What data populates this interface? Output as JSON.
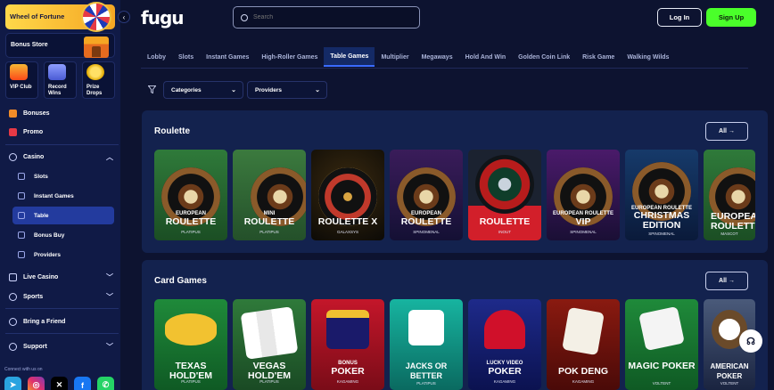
{
  "sidebar": {
    "wheel_label": "Wheel of Fortune",
    "bonus_store_label": "Bonus Store",
    "tiles": [
      {
        "label": "VIP Club",
        "icon": "crown-icon"
      },
      {
        "label": "Record Wins",
        "icon": "trophy-icon"
      },
      {
        "label": "Prize Drops",
        "icon": "coin-icon"
      }
    ],
    "items": {
      "bonuses": "Bonuses",
      "promo": "Promo",
      "casino": "Casino",
      "slots": "Slots",
      "instant_games": "Instant Games",
      "table": "Table",
      "bonus_buy": "Bonus Buy",
      "providers": "Providers",
      "live_casino": "Live Casino",
      "sports": "Sports",
      "bring_friend": "Bring a Friend",
      "support": "Support"
    },
    "connect_label": "Connect with us on",
    "socials": [
      "telegram-icon",
      "instagram-icon",
      "x-icon",
      "facebook-icon",
      "whatsapp-icon"
    ]
  },
  "header": {
    "logo": "fugu",
    "search_placeholder": "Search",
    "login_label": "Log In",
    "signup_label": "Sign Up"
  },
  "tabs": [
    "Lobby",
    "Slots",
    "Instant Games",
    "High-Roller Games",
    "Table Games",
    "Multiplier",
    "Megaways",
    "Hold And Win",
    "Golden Coin Link",
    "Risk Game",
    "Walking Wilds"
  ],
  "active_tab": "Table Games",
  "filters": {
    "categories_label": "Categories",
    "providers_label": "Providers"
  },
  "roulette": {
    "title": "Roulette",
    "all_label": "All",
    "games": [
      {
        "line1": "EUROPEAN",
        "line2": "ROULETTE",
        "provider": "PLATIPUS"
      },
      {
        "line1": "MINI",
        "line2": "ROULETTE",
        "provider": "PLATIPUS"
      },
      {
        "line1": "",
        "line2": "ROULETTE X",
        "provider": "GALAXSYS"
      },
      {
        "line1": "EUROPEAN",
        "line2": "ROULETTE",
        "provider": "SPINOMENAL"
      },
      {
        "line1": "",
        "line2": "ROULETTE",
        "provider": "INOUT"
      },
      {
        "line1": "EUROPEAN ROULETTE",
        "line2": "VIP",
        "provider": "SPINOMENAL"
      },
      {
        "line1": "EUROPEAN ROULETTE",
        "line2": "CHRISTMAS EDITION",
        "provider": "SPINOMENAL"
      },
      {
        "line1": "",
        "line2": "EUROPEAN ROULETTE",
        "provider": "MASCOT"
      }
    ]
  },
  "card_games": {
    "title": "Card Games",
    "all_label": "All",
    "games": [
      {
        "line1": "",
        "line2": "TEXAS HOLD'EM",
        "provider": "PLATIPUS"
      },
      {
        "line1": "",
        "line2": "VEGAS HOLD'EM",
        "provider": "PLATIPUS"
      },
      {
        "line1": "BONUS",
        "line2": "POKER",
        "provider": "KAGAMING"
      },
      {
        "line1": "",
        "line2": "JACKS OR BETTER",
        "provider": "PLATIPUS"
      },
      {
        "line1": "LUCKY VIDEO",
        "line2": "POKER",
        "provider": "KAGAMING"
      },
      {
        "line1": "",
        "line2": "POK DENG",
        "provider": "KAGAMING"
      },
      {
        "line1": "",
        "line2": "MAGIC POKER",
        "provider": "VOLTENT"
      },
      {
        "line1": "",
        "line2": "AMERICAN POKER",
        "provider": "VOLTENT"
      }
    ]
  },
  "colors": {
    "accent_green": "#4aff2a",
    "active_blue": "#233b9e",
    "panel": "#13224e"
  }
}
